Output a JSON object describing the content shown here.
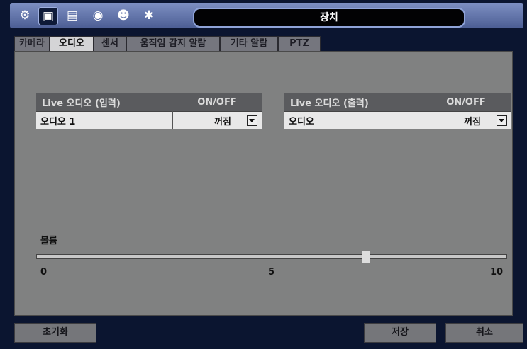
{
  "title": "장치",
  "toolbar_icons": [
    "gear-icon",
    "camera-dome-icon",
    "monitor-icon",
    "network-icon",
    "users-icon",
    "system-settings-icon"
  ],
  "tabs": [
    "카메라",
    "오디오",
    "센서",
    "움직임 감지 알람",
    "기타 알람",
    "PTZ"
  ],
  "active_tab": "오디오",
  "input_table": {
    "header_name": "Live 오디오 (입력)",
    "header_onoff": "ON/OFF",
    "row_name": "오디오 1",
    "row_value": "꺼짐"
  },
  "output_table": {
    "header_name": "Live 오디오 (출력)",
    "header_onoff": "ON/OFF",
    "row_name": "오디오",
    "row_value": "꺼짐"
  },
  "volume": {
    "label": "볼륨",
    "min": "0",
    "mid": "5",
    "max": "10",
    "value": 7
  },
  "buttons": {
    "reset": "초기화",
    "save": "저장",
    "cancel": "취소"
  }
}
